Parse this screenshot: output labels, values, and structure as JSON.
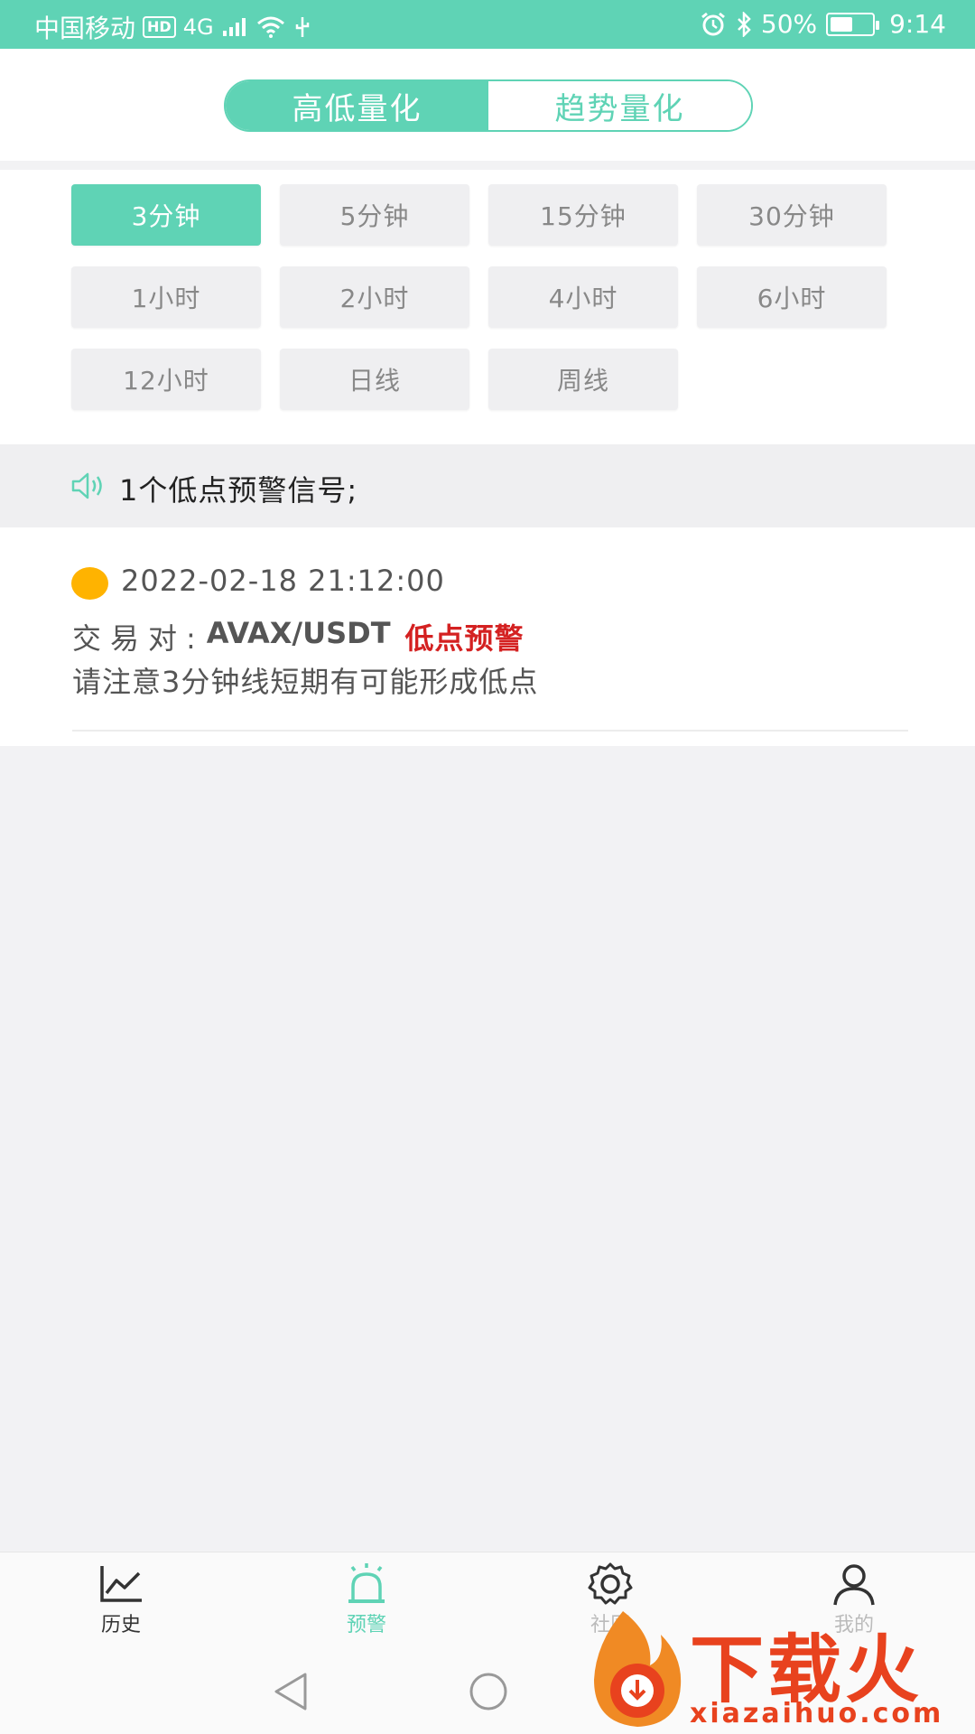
{
  "status_bar": {
    "carrier": "中国移动",
    "hd": "HD",
    "network": "4G",
    "battery_percent": "50%",
    "time": "9:14",
    "battery_level": 0.5
  },
  "header": {
    "tabs": [
      {
        "label": "高低量化",
        "active": true
      },
      {
        "label": "趋势量化",
        "active": false
      }
    ]
  },
  "intervals": [
    {
      "label": "3分钟",
      "active": true
    },
    {
      "label": "5分钟",
      "active": false
    },
    {
      "label": "15分钟",
      "active": false
    },
    {
      "label": "30分钟",
      "active": false
    },
    {
      "label": "1小时",
      "active": false
    },
    {
      "label": "2小时",
      "active": false
    },
    {
      "label": "4小时",
      "active": false
    },
    {
      "label": "6小时",
      "active": false
    },
    {
      "label": "12小时",
      "active": false
    },
    {
      "label": "日线",
      "active": false
    },
    {
      "label": "周线",
      "active": false
    }
  ],
  "signal_summary": "1个低点预警信号;",
  "alerts": [
    {
      "datetime": "2022-02-18 21:12:00",
      "pair_label": "交易对:",
      "pair": "AVAX/USDT",
      "tag": "低点预警",
      "description": "请注意3分钟线短期有可能形成低点"
    }
  ],
  "bottom_nav": [
    {
      "label": "历史",
      "icon": "chart-line-icon"
    },
    {
      "label": "预警",
      "icon": "alarm-icon"
    },
    {
      "label": "社区",
      "icon": "gear-icon"
    },
    {
      "label": "我的",
      "icon": "user-icon"
    }
  ],
  "watermark": {
    "title": "下载火",
    "url": "xiazaihuo.com"
  },
  "colors": {
    "accent": "#5fd3b5",
    "alert_red": "#d42121",
    "dot": "#ffb300"
  }
}
